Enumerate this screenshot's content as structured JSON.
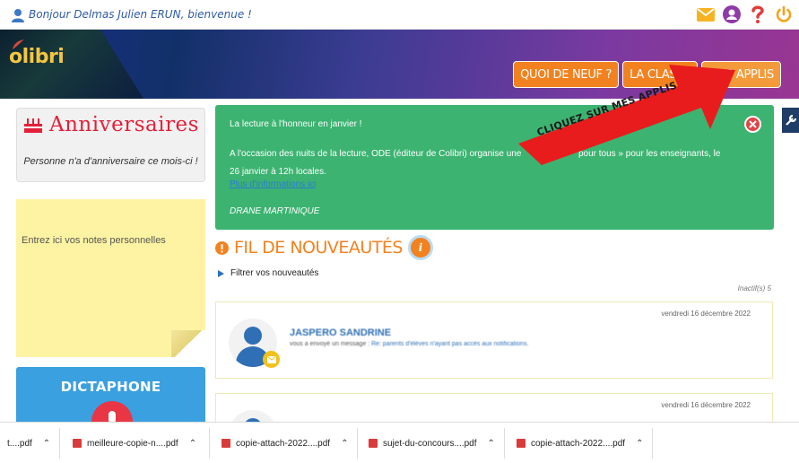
{
  "topbar": {
    "greeting": "Bonjour Delmas Julien ERUN, bienvenue !",
    "icons": [
      "user-icon",
      "mail-icon",
      "account-icon",
      "help-icon",
      "power-icon"
    ]
  },
  "banner": {
    "logo_text": "olibri",
    "nav": [
      {
        "label": "QUOI DE NEUF ?"
      },
      {
        "label": "LA CLASSE"
      },
      {
        "label": "MES APPLIS"
      }
    ]
  },
  "birthdays": {
    "title": "Anniversaires",
    "message": "Personne n'a d'anniversaire ce mois-ci !"
  },
  "notes": {
    "placeholder": "Entrez ici vos notes personnelles"
  },
  "dictaphone": {
    "title": "DICTAPHONE"
  },
  "notice": {
    "title": "La lecture à l'honneur en janvier !",
    "body_part1": "A l'occasion des nuits de la lecture, ODE (éditeur de Colibri) organise une",
    "body_part2": "pour tous » pour les enseignants, le",
    "body_line2": "26 janvier à 12h locales.",
    "link": "Plus d'informations ici",
    "signature": "DRANE MARTINIQUE"
  },
  "annotation": {
    "text": "CLIQUEZ SUR MES APPLIS",
    "color": "#e81c1c"
  },
  "feed": {
    "title": "FIL DE NOUVEAUTÉS",
    "info": "i",
    "filter": "Filtrer vos nouveautés",
    "inactive": "Inactif(s) 5",
    "items": [
      {
        "date": "vendredi 16 décembre 2022",
        "sender": "JASPERO SANDRINE",
        "message_prefix": "vous a envoyé un message :",
        "message_link": "Re: parents d'élèves n'ayant pas accès aux notifications."
      },
      {
        "date": "vendredi 16 décembre 2022"
      }
    ]
  },
  "downloads": [
    {
      "name": "t....pdf"
    },
    {
      "name": "meilleure-copie-n....pdf"
    },
    {
      "name": "copie-attach-2022....pdf"
    },
    {
      "name": "sujet-du-concours....pdf"
    },
    {
      "name": "copie-attach-2022....pdf"
    }
  ],
  "colors": {
    "accent": "#f2821f",
    "notice_green": "#3cb371",
    "link_blue": "#2f6fb5"
  }
}
